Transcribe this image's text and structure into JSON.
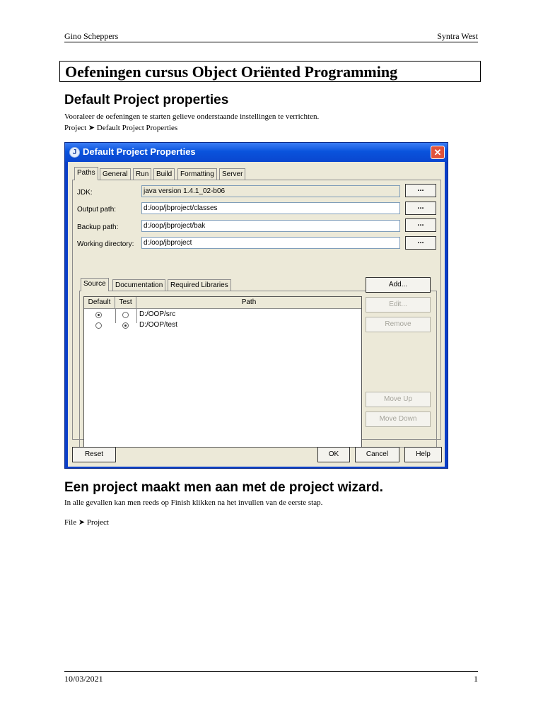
{
  "header": {
    "author": "Gino Scheppers",
    "org": "Syntra West"
  },
  "doc_title": "Oefeningen cursus Object Oriënted Programming",
  "section1": {
    "heading": "Default Project properties",
    "line1": "Vooraleer de oefeningen te starten gelieve onderstaande instellingen te verrichten.",
    "line2": "Project ➤ Default Project Properties"
  },
  "dialog": {
    "title": "Default Project Properties",
    "close_glyph": "✕",
    "app_icon": "J",
    "tabs": [
      "Paths",
      "General",
      "Run",
      "Build",
      "Formatting",
      "Server"
    ],
    "fields": [
      {
        "label": "JDK:",
        "value": "java version 1.4.1_02-b06"
      },
      {
        "label": "Output path:",
        "value": "d:/oop/jbproject/classes"
      },
      {
        "label": "Backup path:",
        "value": "d:/oop/jbproject/bak"
      },
      {
        "label": "Working directory:",
        "value": "d:/oop/jbproject"
      }
    ],
    "browse_label": "...",
    "inner_tabs": [
      "Source",
      "Documentation",
      "Required Libraries"
    ],
    "table": {
      "headers": [
        "Default",
        "Test",
        "Path"
      ],
      "rows": [
        {
          "default": true,
          "test": false,
          "path": "D:/OOP/src"
        },
        {
          "default": false,
          "test": true,
          "path": "D:/OOP/test"
        }
      ]
    },
    "side_buttons": {
      "add": "Add...",
      "edit": "Edit...",
      "remove": "Remove",
      "move_up": "Move Up",
      "move_down": "Move Down"
    },
    "bottom_buttons": {
      "reset": "Reset",
      "ok": "OK",
      "cancel": "Cancel",
      "help": "Help"
    }
  },
  "section2": {
    "heading": "Een project maakt men aan met de project wizard.",
    "line1": "In alle gevallen kan men reeds op Finish klikken na het invullen van de eerste stap.",
    "line2": "File ➤ Project"
  },
  "footer": {
    "date": "10/03/2021",
    "page": "1"
  }
}
